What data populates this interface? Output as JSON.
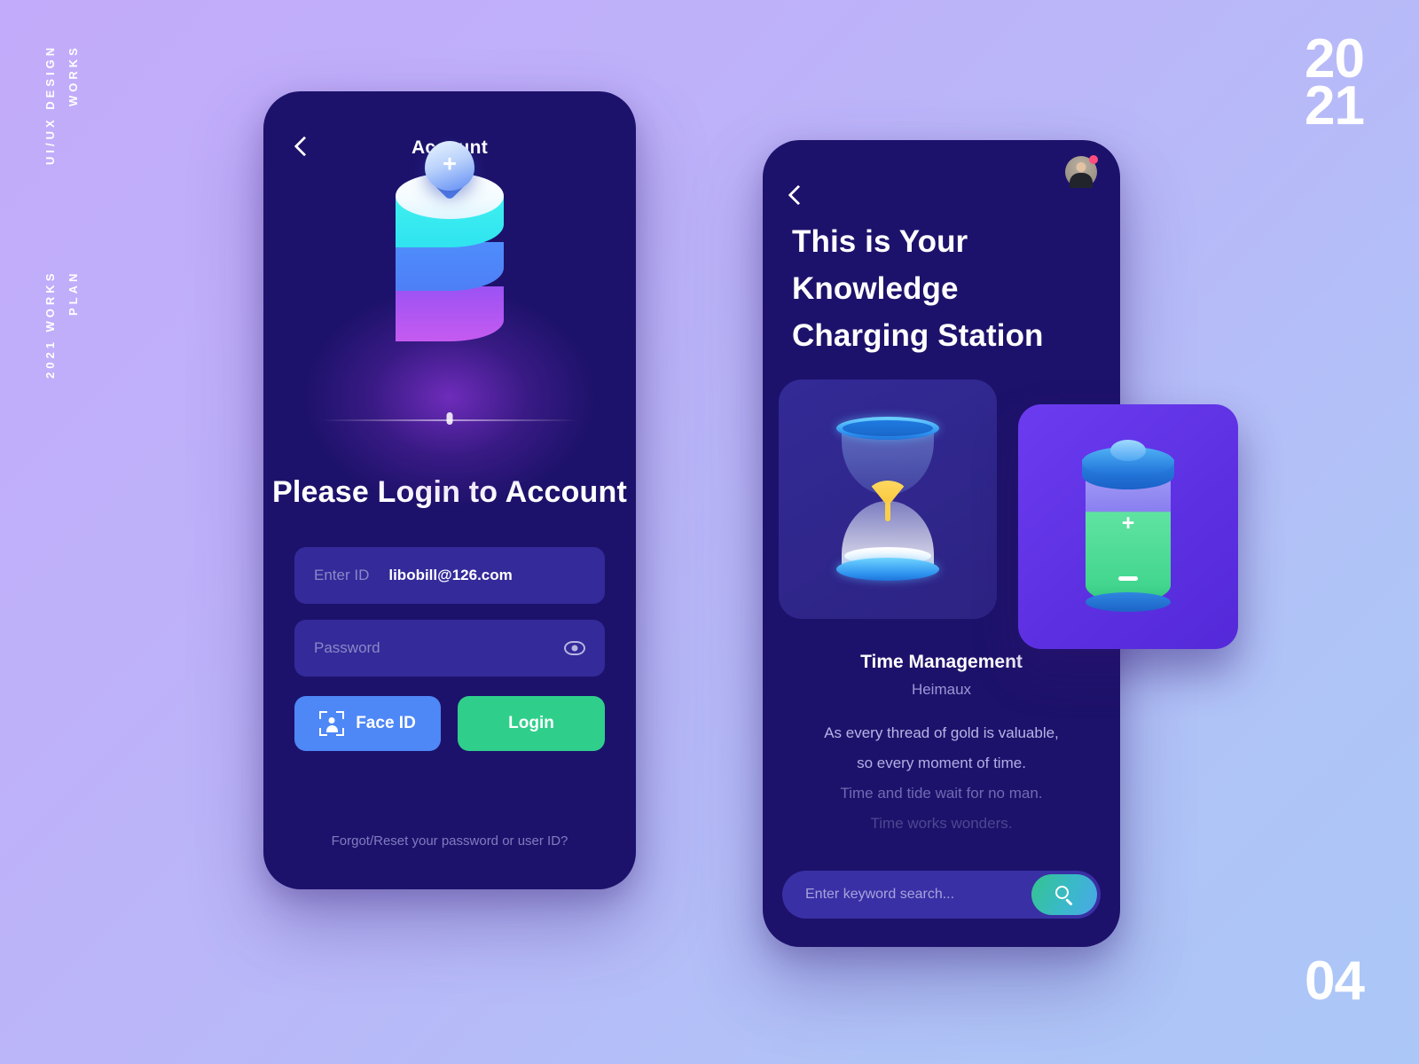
{
  "canvas": {
    "side_label_top": [
      "UI/UX DESIGN",
      "WORKS"
    ],
    "side_label_bottom": [
      "2021 WORKS",
      "PLAN"
    ],
    "year_top": "20",
    "year_bottom": "21",
    "page_number": "04",
    "bg_start": "#c2abfa",
    "bg_end": "#abc7f7"
  },
  "login_screen": {
    "back_icon": "chevron-left-icon",
    "title": "Account",
    "illustration": {
      "pin_icon": "map-pin-plus-icon",
      "plus": "+"
    },
    "headline": "Please Login to Account",
    "id_field": {
      "label": "Enter ID",
      "value": "libobill@126.com"
    },
    "password_field": {
      "placeholder": "Password",
      "eye_icon": "eye-icon"
    },
    "face_button": {
      "label": "Face ID",
      "icon": "face-id-icon",
      "color": "#4e87f6"
    },
    "login_button": {
      "label": "Login",
      "color": "#2fcf8b"
    },
    "forgot_link": "Forgot/Reset your password or user ID?"
  },
  "knowledge_screen": {
    "back_icon": "chevron-left-icon",
    "avatar_icon": "avatar",
    "notification_dot": "#ff4d7e",
    "headline": "This is Your Knowledge Charging Station",
    "cards": [
      {
        "name": "time-card",
        "icon": "hourglass-icon",
        "color": "#332a96"
      },
      {
        "name": "battery-card",
        "icon": "battery-icon",
        "color": "#6c3bf0",
        "plus": "+"
      }
    ],
    "content_title": "Time Management",
    "content_author": "Heimaux",
    "quote_lines": [
      "As every thread of gold is valuable,",
      "so every moment of time.",
      "Time and tide wait for no man.",
      "Time works wonders."
    ],
    "search": {
      "placeholder": "Enter keyword search...",
      "button_icon": "search-icon"
    }
  }
}
